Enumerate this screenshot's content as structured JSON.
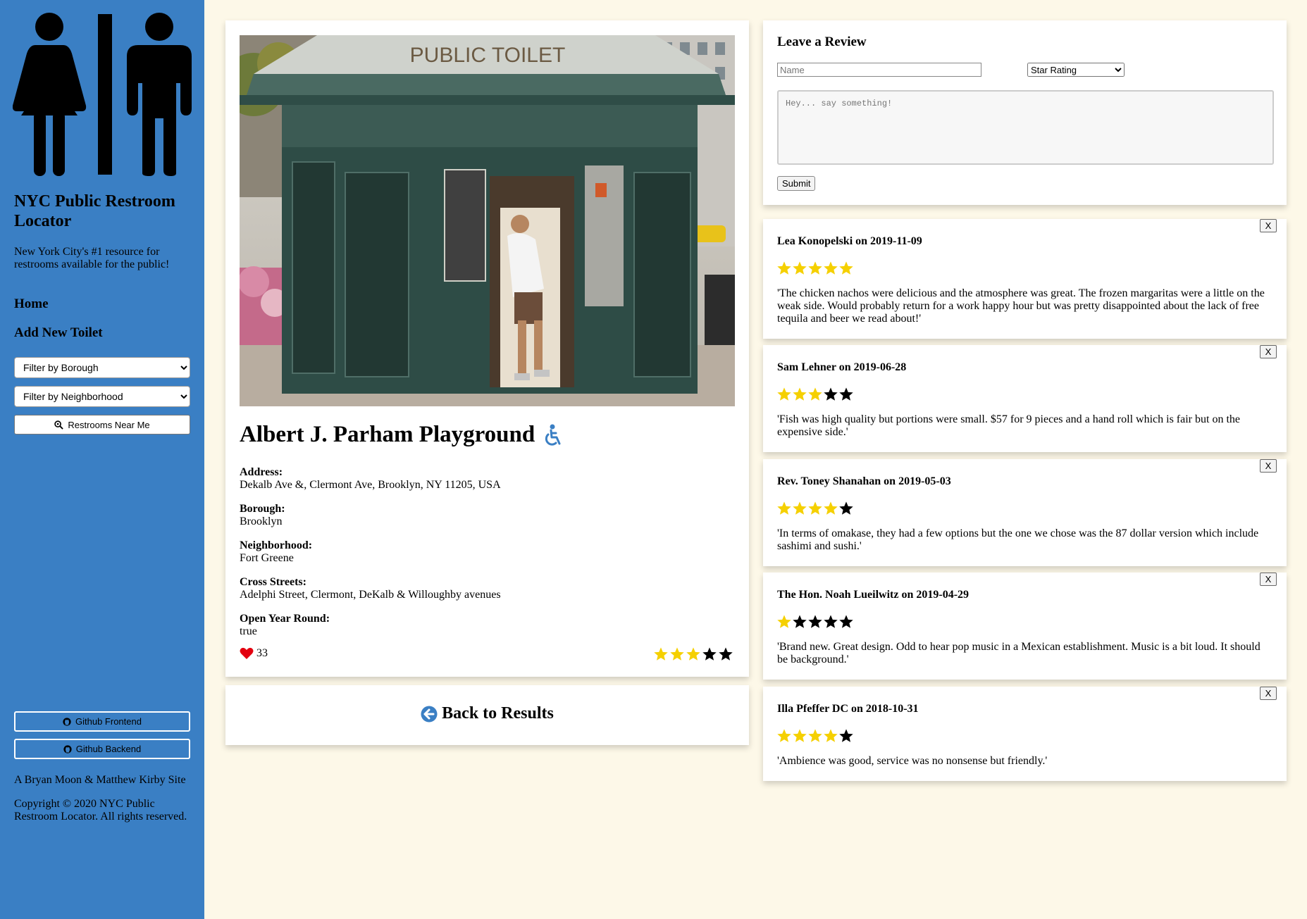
{
  "sidebar": {
    "title": "NYC Public Restroom Locator",
    "tagline": "New York City's #1 resource for restrooms available for the public!",
    "nav": {
      "home": "Home",
      "add_toilet": "Add New Toilet"
    },
    "filter_borough": "Filter by Borough",
    "filter_neighborhood": "Filter by Neighborhood",
    "near_me_label": "Restrooms Near Me",
    "github_frontend": "Github Frontend",
    "github_backend": "Github Backend",
    "credit": "A Bryan Moon & Matthew Kirby Site",
    "copyright": "Copyright © 2020 NYC Public Restroom Locator. All rights reserved."
  },
  "toilet": {
    "photo_sign": "PUBLIC TOILET",
    "name": "Albert J. Parham Playground",
    "accessible_icon": "wheelchair-icon",
    "address_label": "Address:",
    "address": "Dekalb Ave &, Clermont Ave, Brooklyn, NY 11205, USA",
    "borough_label": "Borough:",
    "borough": "Brooklyn",
    "neighborhood_label": "Neighborhood:",
    "neighborhood": "Fort Greene",
    "cross_label": "Cross Streets:",
    "cross_streets": "Adelphi Street, Clermont, DeKalb & Willoughby avenues",
    "open_label": "Open Year Round:",
    "open_year_round": "true",
    "likes": "33",
    "rating": 3
  },
  "back_label": "Back to Results",
  "review_form": {
    "title": "Leave a Review",
    "name_placeholder": "Name",
    "star_select": "Star Rating",
    "comment_placeholder": "Hey... say something!",
    "submit": "Submit"
  },
  "reviews": [
    {
      "heading": "Lea Konopelski on 2019-11-09",
      "rating": 5,
      "text": "'The chicken nachos were delicious and the atmosphere was great. The frozen margaritas were a little on the weak side. Would probably return for a work happy hour but was pretty disappointed about the lack of free tequila and beer we read about!'"
    },
    {
      "heading": "Sam Lehner on 2019-06-28",
      "rating": 3,
      "text": "'Fish was high quality but portions were small. $57 for 9 pieces and a hand roll which is fair but on the expensive side.'"
    },
    {
      "heading": "Rev. Toney Shanahan on 2019-05-03",
      "rating": 4,
      "text": "'In terms of omakase, they had a few options but the one we chose was the 87 dollar version which include sashimi and sushi.'"
    },
    {
      "heading": "The Hon. Noah Lueilwitz on 2019-04-29",
      "rating": 1,
      "text": "'Brand new. Great design. Odd to hear pop music in a Mexican establishment. Music is a bit loud. It should be background.'"
    },
    {
      "heading": "Illa Pfeffer DC on 2018-10-31",
      "rating": 4,
      "text": "'Ambience was good, service was no nonsense but friendly.'"
    }
  ],
  "close_label": "X",
  "colors": {
    "sidebar": "#3a7fc4",
    "background": "#fdf8e8",
    "star_on": "#f5d000",
    "star_off": "#000000",
    "heart": "#e3000f"
  }
}
